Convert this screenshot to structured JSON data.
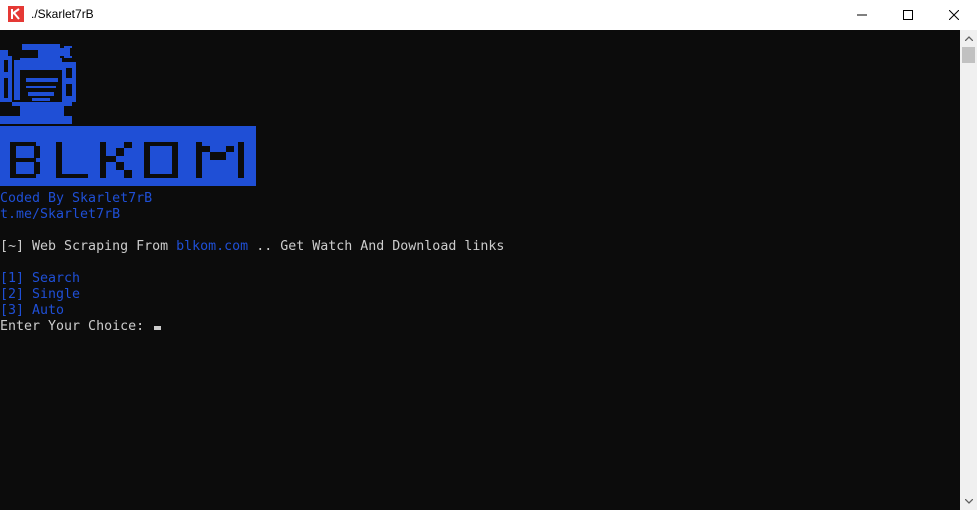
{
  "window": {
    "title": "./Skarlet7rB",
    "app_icon": "k-app-icon",
    "controls": [
      "minimize-icon",
      "maximize-icon",
      "close-icon"
    ]
  },
  "terminal": {
    "logo_text": "BLKOM",
    "credit_line": "Coded By Skarlet7rB",
    "link_line": "t.me/Skarlet7rB",
    "intro": {
      "prefix": "[~] Web Scraping From ",
      "site": "blkom.com",
      "suffix": " .. Get Watch And Download links"
    },
    "menu": [
      "[1] Search",
      "[2] Single",
      "[3] Auto"
    ],
    "prompt": "Enter Your Choice: "
  },
  "colors": {
    "background": "#0c0c0c",
    "accent_blue": "#1f4fd6",
    "text": "#cccccc"
  }
}
